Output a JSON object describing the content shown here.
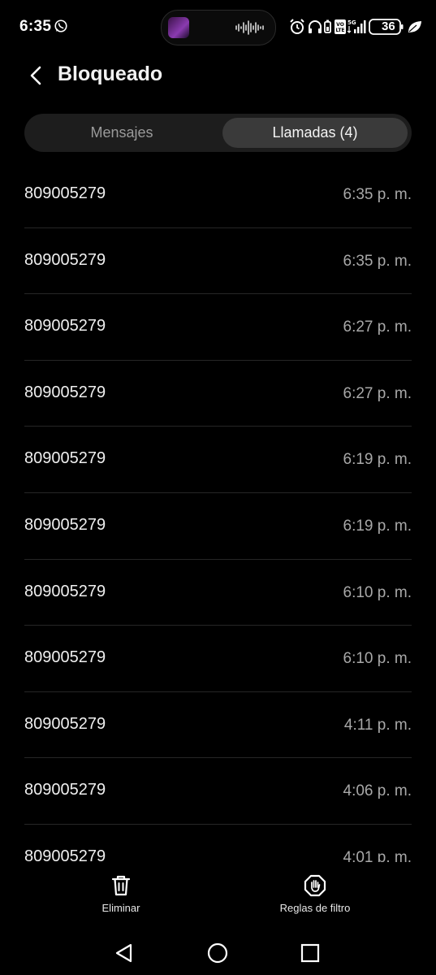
{
  "status_bar": {
    "time": "6:35",
    "battery": "36"
  },
  "header": {
    "title": "Bloqueado"
  },
  "tabs": [
    {
      "label": "Mensajes",
      "selected": false
    },
    {
      "label": "Llamadas (4)",
      "selected": true
    }
  ],
  "calls": [
    {
      "number": "809005279",
      "time": "6:35 p. m."
    },
    {
      "number": "809005279",
      "time": "6:35 p. m."
    },
    {
      "number": "809005279",
      "time": "6:27 p. m."
    },
    {
      "number": "809005279",
      "time": "6:27 p. m."
    },
    {
      "number": "809005279",
      "time": "6:19 p. m."
    },
    {
      "number": "809005279",
      "time": "6:19 p. m."
    },
    {
      "number": "809005279",
      "time": "6:10 p. m."
    },
    {
      "number": "809005279",
      "time": "6:10 p. m."
    },
    {
      "number": "809005279",
      "time": "4:11 p. m."
    },
    {
      "number": "809005279",
      "time": "4:06 p. m."
    },
    {
      "number": "809005279",
      "time": "4:01 p. m."
    }
  ],
  "actions": {
    "delete_label": "Eliminar",
    "filter_label": "Reglas de filtro"
  },
  "colors": {
    "background": "#000000",
    "tab_active": "#3a3a3a",
    "tab_track": "#1d1d1d"
  }
}
